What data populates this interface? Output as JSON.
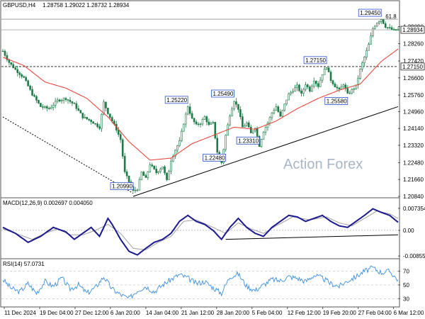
{
  "header": {
    "symbol": "GBPUSD,H4",
    "ohlc": "1.28758 1.29022 1.28732 1.28934"
  },
  "watermark": "Action Forex",
  "colors": {
    "bull": "#1f7a46",
    "bear": "#1f7a46",
    "ma": "#e8392d",
    "macd": "#1a1a8c",
    "signal": "#a0a0a0",
    "rsi": "#3b8fe0",
    "trend": "#000000"
  },
  "chart_data": [
    {
      "type": "candlestick",
      "title": "GBPUSD,H4",
      "ylim": [
        1.2084,
        1.299
      ],
      "y_ticks": [
        "1.29090",
        "1.28260",
        "1.27420",
        "1.26600",
        "1.25760",
        "1.24960",
        "1.24140",
        "1.23320",
        "1.22480",
        "1.21660",
        "1.20840"
      ],
      "x_ticks": [
        "11 Dec 2024",
        "19 Dec 04:00",
        "27 Dec 12:00",
        "6 Jan 20:00",
        "14 Jan 04:00",
        "21 Jan 12:00",
        "28 Jan 20:00",
        "5 Feb 04:00",
        "12 Feb 12:00",
        "19 Feb 20:00",
        "27 Feb 04:00",
        "6 Mar 12:00"
      ],
      "current_price": "1.28934",
      "level_line": "1.27150",
      "top_line": "1.29450",
      "annotations": [
        {
          "label": "1.20990",
          "value": 1.2099
        },
        {
          "label": "1.25220",
          "value": 1.2522
        },
        {
          "label": "1.22480",
          "value": 1.2248
        },
        {
          "label": "1.25490",
          "value": 1.2549
        },
        {
          "label": "1.23310",
          "value": 1.2331
        },
        {
          "label": "1.27150",
          "value": 1.2715
        },
        {
          "label": "1.25580",
          "value": 1.2558
        },
        {
          "label": "1.29450",
          "value": 1.2945
        }
      ],
      "fib_label": "61.8",
      "series": [
        {
          "name": "price",
          "close_path": [
            [
              0,
              1.279
            ],
            [
              3,
              1.2735
            ],
            [
              6,
              1.27
            ],
            [
              10,
              1.266
            ],
            [
              14,
              1.258
            ],
            [
              18,
              1.252
            ],
            [
              22,
              1.251
            ],
            [
              26,
              1.255
            ],
            [
              30,
              1.256
            ],
            [
              34,
              1.253
            ],
            [
              38,
              1.247
            ],
            [
              42,
              1.245
            ],
            [
              46,
              1.242
            ],
            [
              48,
              1.254
            ],
            [
              50,
              1.249
            ],
            [
              54,
              1.241
            ],
            [
              56,
              1.236
            ],
            [
              58,
              1.22
            ],
            [
              62,
              1.211
            ],
            [
              64,
              1.212
            ],
            [
              66,
              1.22
            ],
            [
              68,
              1.217
            ],
            [
              70,
              1.224
            ],
            [
              73,
              1.22
            ],
            [
              76,
              1.223
            ],
            [
              78,
              1.216
            ],
            [
              80,
              1.226
            ],
            [
              82,
              1.231
            ],
            [
              84,
              1.235
            ],
            [
              86,
              1.244
            ],
            [
              88,
              1.2522
            ],
            [
              90,
              1.246
            ],
            [
              92,
              1.243
            ],
            [
              94,
              1.244
            ],
            [
              96,
              1.247
            ],
            [
              98,
              1.243
            ],
            [
              100,
              1.244
            ],
            [
              102,
              1.23
            ],
            [
              104,
              1.2248
            ],
            [
              106,
              1.238
            ],
            [
              108,
              1.248
            ],
            [
              110,
              1.2549
            ],
            [
              112,
              1.251
            ],
            [
              114,
              1.242
            ],
            [
              116,
              1.244
            ],
            [
              118,
              1.239
            ],
            [
              120,
              1.242
            ],
            [
              122,
              1.2331
            ],
            [
              124,
              1.24
            ],
            [
              126,
              1.244
            ],
            [
              128,
              1.249
            ],
            [
              130,
              1.252
            ],
            [
              132,
              1.247
            ],
            [
              134,
              1.253
            ],
            [
              136,
              1.258
            ],
            [
              138,
              1.26
            ],
            [
              140,
              1.262
            ],
            [
              142,
              1.258
            ],
            [
              144,
              1.263
            ],
            [
              146,
              1.26
            ],
            [
              148,
              1.265
            ],
            [
              150,
              1.262
            ],
            [
              152,
              1.268
            ],
            [
              154,
              1.2715
            ],
            [
              156,
              1.265
            ],
            [
              158,
              1.262
            ],
            [
              160,
              1.26
            ],
            [
              162,
              1.263
            ],
            [
              164,
              1.258
            ],
            [
              166,
              1.26
            ],
            [
              168,
              1.262
            ],
            [
              170,
              1.27
            ],
            [
              172,
              1.276
            ],
            [
              174,
              1.282
            ],
            [
              176,
              1.29
            ],
            [
              178,
              1.293
            ],
            [
              180,
              1.2945
            ],
            [
              182,
              1.291
            ],
            [
              184,
              1.29
            ],
            [
              186,
              1.289
            ],
            [
              188,
              1.2893
            ]
          ]
        },
        {
          "name": "MA",
          "path": [
            [
              0,
              1.276
            ],
            [
              10,
              1.272
            ],
            [
              20,
              1.264
            ],
            [
              30,
              1.261
            ],
            [
              40,
              1.256
            ],
            [
              50,
              1.247
            ],
            [
              60,
              1.235
            ],
            [
              70,
              1.226
            ],
            [
              80,
              1.227
            ],
            [
              90,
              1.234
            ],
            [
              100,
              1.238
            ],
            [
              110,
              1.242
            ],
            [
              120,
              1.241
            ],
            [
              130,
              1.245
            ],
            [
              140,
              1.251
            ],
            [
              150,
              1.256
            ],
            [
              160,
              1.26
            ],
            [
              170,
              1.263
            ],
            [
              180,
              1.274
            ],
            [
              188,
              1.28
            ]
          ]
        },
        {
          "name": "trendline",
          "path": [
            [
              62,
              1.2084
            ],
            [
              188,
              1.252
            ]
          ]
        },
        {
          "name": "dotted_trend",
          "path": [
            [
              0,
              1.247
            ],
            [
              62,
              1.2099
            ]
          ]
        }
      ]
    },
    {
      "type": "line",
      "title": "MACD(12,26,9) 0.002697 0.004050",
      "ylim": [
        -0.009,
        0.0078
      ],
      "y_ticks": [
        "0.007354",
        "0.00",
        "-0.008558"
      ],
      "series": [
        {
          "name": "MACD",
          "path": [
            [
              0,
              0.001
            ],
            [
              6,
              -0.001
            ],
            [
              12,
              -0.004
            ],
            [
              18,
              -0.002
            ],
            [
              24,
              0.001
            ],
            [
              30,
              -0.0005
            ],
            [
              34,
              -0.003
            ],
            [
              38,
              -0.001
            ],
            [
              42,
              0.001
            ],
            [
              46,
              -0.002
            ],
            [
              50,
              0.004
            ],
            [
              52,
              0.002
            ],
            [
              56,
              -0.003
            ],
            [
              60,
              -0.007
            ],
            [
              64,
              -0.0082
            ],
            [
              68,
              -0.006
            ],
            [
              72,
              -0.004
            ],
            [
              76,
              -0.003
            ],
            [
              80,
              -0.001
            ],
            [
              84,
              0.003
            ],
            [
              88,
              0.005
            ],
            [
              92,
              0.003
            ],
            [
              96,
              0.002
            ],
            [
              100,
              0.0
            ],
            [
              104,
              -0.003
            ],
            [
              108,
              0.001
            ],
            [
              112,
              0.004
            ],
            [
              116,
              0.001
            ],
            [
              120,
              -0.001
            ],
            [
              124,
              -0.002
            ],
            [
              128,
              0.001
            ],
            [
              132,
              0.003
            ],
            [
              136,
              0.005
            ],
            [
              140,
              0.0045
            ],
            [
              144,
              0.003
            ],
            [
              148,
              0.004
            ],
            [
              152,
              0.005
            ],
            [
              156,
              0.003
            ],
            [
              160,
              0.0015
            ],
            [
              164,
              0.001
            ],
            [
              168,
              0.003
            ],
            [
              172,
              0.005
            ],
            [
              176,
              0.0072
            ],
            [
              180,
              0.006
            ],
            [
              184,
              0.005
            ],
            [
              188,
              0.0027
            ]
          ]
        },
        {
          "name": "Signal",
          "path": [
            [
              0,
              0.0005
            ],
            [
              8,
              -0.0015
            ],
            [
              14,
              -0.003
            ],
            [
              20,
              -0.001
            ],
            [
              26,
              0.0005
            ],
            [
              32,
              -0.0015
            ],
            [
              38,
              -0.0015
            ],
            [
              44,
              0.0
            ],
            [
              50,
              0.002
            ],
            [
              56,
              -0.001
            ],
            [
              62,
              -0.006
            ],
            [
              68,
              -0.0065
            ],
            [
              74,
              -0.004
            ],
            [
              80,
              -0.002
            ],
            [
              86,
              0.003
            ],
            [
              92,
              0.0035
            ],
            [
              100,
              0.001
            ],
            [
              106,
              -0.001
            ],
            [
              112,
              0.0025
            ],
            [
              118,
              0.0005
            ],
            [
              124,
              -0.001
            ],
            [
              130,
              0.0015
            ],
            [
              138,
              0.0045
            ],
            [
              146,
              0.0035
            ],
            [
              154,
              0.0045
            ],
            [
              160,
              0.0025
            ],
            [
              166,
              0.0015
            ],
            [
              172,
              0.004
            ],
            [
              178,
              0.0065
            ],
            [
              184,
              0.0055
            ],
            [
              188,
              0.004
            ]
          ]
        },
        {
          "name": "support",
          "path": [
            [
              106,
              -0.003
            ],
            [
              188,
              -0.0015
            ]
          ]
        }
      ]
    },
    {
      "type": "line",
      "title": "RSI(14) 57.0731",
      "ylim": [
        20,
        85
      ],
      "y_ticks": [
        "70",
        "50",
        "30"
      ],
      "series": [
        {
          "name": "RSI",
          "path": [
            [
              0,
              58
            ],
            [
              4,
              45
            ],
            [
              8,
              40
            ],
            [
              12,
              52
            ],
            [
              16,
              38
            ],
            [
              20,
              55
            ],
            [
              24,
              48
            ],
            [
              28,
              60
            ],
            [
              32,
              44
            ],
            [
              36,
              50
            ],
            [
              40,
              38
            ],
            [
              44,
              46
            ],
            [
              48,
              62
            ],
            [
              52,
              44
            ],
            [
              56,
              36
            ],
            [
              60,
              30
            ],
            [
              64,
              42
            ],
            [
              68,
              48
            ],
            [
              72,
              40
            ],
            [
              76,
              50
            ],
            [
              80,
              58
            ],
            [
              84,
              65
            ],
            [
              88,
              60
            ],
            [
              92,
              52
            ],
            [
              96,
              55
            ],
            [
              100,
              46
            ],
            [
              104,
              38
            ],
            [
              108,
              62
            ],
            [
              112,
              66
            ],
            [
              116,
              48
            ],
            [
              120,
              42
            ],
            [
              124,
              50
            ],
            [
              128,
              58
            ],
            [
              132,
              56
            ],
            [
              136,
              62
            ],
            [
              140,
              60
            ],
            [
              144,
              55
            ],
            [
              148,
              64
            ],
            [
              152,
              60
            ],
            [
              156,
              52
            ],
            [
              160,
              48
            ],
            [
              164,
              56
            ],
            [
              168,
              62
            ],
            [
              172,
              70
            ],
            [
              176,
              75
            ],
            [
              180,
              68
            ],
            [
              184,
              70
            ],
            [
              188,
              57
            ]
          ]
        }
      ]
    }
  ]
}
